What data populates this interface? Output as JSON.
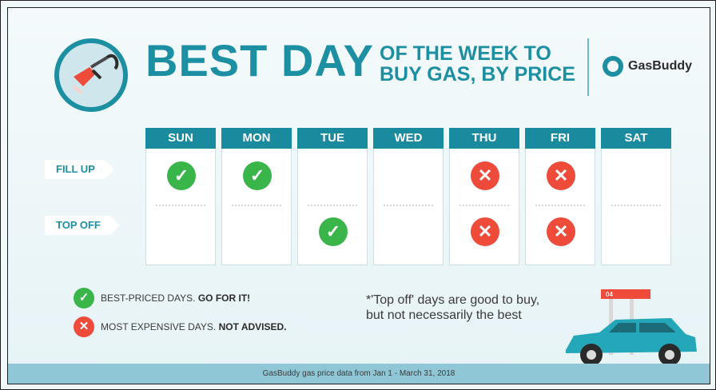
{
  "header": {
    "title_main": "BEST DAY",
    "title_sub_line1": "OF THE WEEK TO",
    "title_sub_line2": "BUY GAS, BY PRICE",
    "brand": "GasBuddy"
  },
  "rows": {
    "fill_up": "FILL UP",
    "top_off": "TOP OFF"
  },
  "days": [
    {
      "label": "SUN",
      "fill_up": "best",
      "top_off": ""
    },
    {
      "label": "MON",
      "fill_up": "best",
      "top_off": ""
    },
    {
      "label": "TUE",
      "fill_up": "",
      "top_off": "best"
    },
    {
      "label": "WED",
      "fill_up": "",
      "top_off": ""
    },
    {
      "label": "THU",
      "fill_up": "expensive",
      "top_off": "expensive"
    },
    {
      "label": "FRI",
      "fill_up": "expensive",
      "top_off": "expensive"
    },
    {
      "label": "SAT",
      "fill_up": "",
      "top_off": ""
    }
  ],
  "legend": {
    "best_prefix": "BEST-PRICED DAYS. ",
    "best_bold": "GO FOR IT!",
    "expensive_prefix": "MOST EXPENSIVE DAYS. ",
    "expensive_bold": "NOT ADVISED."
  },
  "note": {
    "line1": "*'Top off' days are good to buy,",
    "line2": "but not necessarily the best"
  },
  "footer": {
    "text": "GasBuddy gas price data from Jan 1 - March 31, 2018"
  },
  "car": {
    "pump_label": "04"
  },
  "colors": {
    "brand_teal": "#1d8fa3",
    "best_green": "#39b54a",
    "expensive_red": "#ef4b3b"
  }
}
